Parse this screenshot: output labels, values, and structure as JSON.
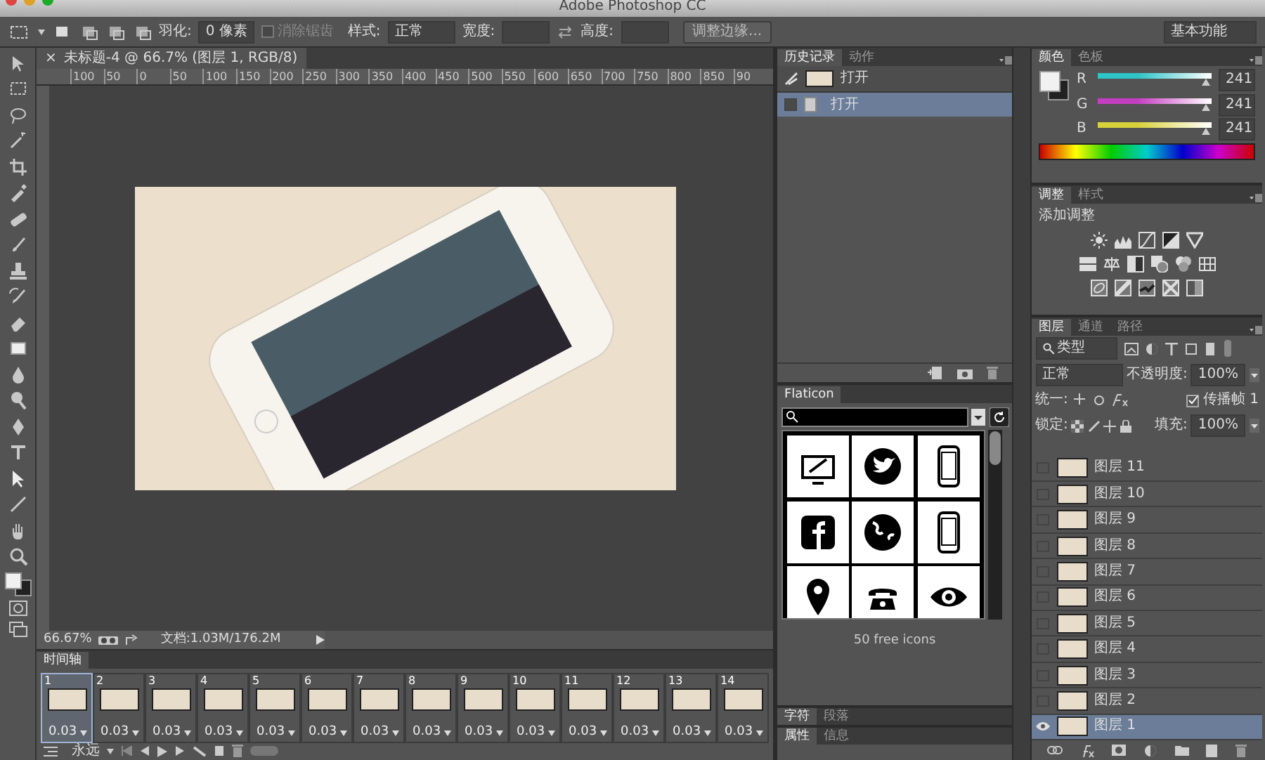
{
  "window": {
    "title": "Adobe Photoshop CC"
  },
  "options_bar": {
    "feather_label": "羽化:",
    "feather_value": "0 像素",
    "antialias": {
      "label": "消除锯齿",
      "checked": false,
      "disabled": true
    },
    "style_label": "样式:",
    "style_value": "正常",
    "width_label": "宽度:",
    "height_label": "高度:",
    "refine_button": "调整边缘...",
    "workspace": "基本功能"
  },
  "document": {
    "tab_title": "未标题-4 @ 66.7% (图层 1, RGB/8)",
    "close": "×",
    "ruler_labels": [
      "100",
      "50",
      "0",
      "50",
      "100",
      "150",
      "200",
      "250",
      "300",
      "350",
      "400",
      "450",
      "500",
      "550",
      "600",
      "650",
      "700",
      "750",
      "800",
      "850",
      "90"
    ],
    "zoom": "66.67%",
    "doc_info": "文档:1.03M/176.2M"
  },
  "history_panel": {
    "tabs": [
      {
        "label": "历史记录",
        "selected": true
      },
      {
        "label": "动作",
        "selected": false
      }
    ],
    "snapshot": "打开",
    "items": [
      {
        "label": "打开",
        "selected": true
      }
    ]
  },
  "flaticon_panel": {
    "tab": "Flaticon",
    "caption": "50 free icons"
  },
  "collapsed_panels": [
    {
      "tabs": [
        "字符",
        "段落"
      ]
    },
    {
      "tabs": [
        "属性",
        "信息"
      ]
    }
  ],
  "color_panel": {
    "tabs": [
      {
        "label": "颜色",
        "selected": true
      },
      {
        "label": "色板",
        "selected": false
      }
    ],
    "channels": [
      {
        "name": "R",
        "value": "241",
        "level": 0.945,
        "color": "#2ec4c8"
      },
      {
        "name": "G",
        "value": "241",
        "level": 0.945,
        "color": "#c43ec2"
      },
      {
        "name": "B",
        "value": "241",
        "level": 0.945,
        "color": "#d8d23a"
      }
    ]
  },
  "adjustments_panel": {
    "tabs": [
      {
        "label": "调整",
        "selected": true
      },
      {
        "label": "样式",
        "selected": false
      }
    ],
    "heading": "添加调整"
  },
  "layers_panel": {
    "tabs": [
      {
        "label": "图层",
        "selected": true
      },
      {
        "label": "通道",
        "selected": false
      },
      {
        "label": "路径",
        "selected": false
      }
    ],
    "filter": "类型",
    "blend_mode": "正常",
    "opacity_label": "不透明度:",
    "opacity": "100%",
    "unify_label": "统一:",
    "propagate": {
      "label": "传播帧 1",
      "checked": true
    },
    "lock_label": "锁定:",
    "fill_label": "填充:",
    "fill": "100%",
    "layers": [
      {
        "name": "图层 11",
        "visible": false,
        "selected": false
      },
      {
        "name": "图层 10",
        "visible": false,
        "selected": false
      },
      {
        "name": "图层 9",
        "visible": false,
        "selected": false
      },
      {
        "name": "图层 8",
        "visible": false,
        "selected": false
      },
      {
        "name": "图层 7",
        "visible": false,
        "selected": false
      },
      {
        "name": "图层 6",
        "visible": false,
        "selected": false
      },
      {
        "name": "图层 5",
        "visible": false,
        "selected": false
      },
      {
        "name": "图层 4",
        "visible": false,
        "selected": false
      },
      {
        "name": "图层 3",
        "visible": false,
        "selected": false
      },
      {
        "name": "图层 2",
        "visible": false,
        "selected": false
      },
      {
        "name": "图层 1",
        "visible": true,
        "selected": true
      }
    ]
  },
  "timeline": {
    "tab": "时间轴",
    "loop": "永远",
    "frames": [
      {
        "number": "1",
        "delay": "0.03",
        "selected": true
      },
      {
        "number": "2",
        "delay": "0.03",
        "selected": false
      },
      {
        "number": "3",
        "delay": "0.03",
        "selected": false
      },
      {
        "number": "4",
        "delay": "0.03",
        "selected": false
      },
      {
        "number": "5",
        "delay": "0.03",
        "selected": false
      },
      {
        "number": "6",
        "delay": "0.03",
        "selected": false
      },
      {
        "number": "7",
        "delay": "0.03",
        "selected": false
      },
      {
        "number": "8",
        "delay": "0.03",
        "selected": false
      },
      {
        "number": "9",
        "delay": "0.03",
        "selected": false
      },
      {
        "number": "10",
        "delay": "0.03",
        "selected": false
      },
      {
        "number": "11",
        "delay": "0.03",
        "selected": false
      },
      {
        "number": "12",
        "delay": "0.03",
        "selected": false
      },
      {
        "number": "13",
        "delay": "0.03",
        "selected": false
      },
      {
        "number": "14",
        "delay": "0.03",
        "selected": false
      }
    ]
  }
}
